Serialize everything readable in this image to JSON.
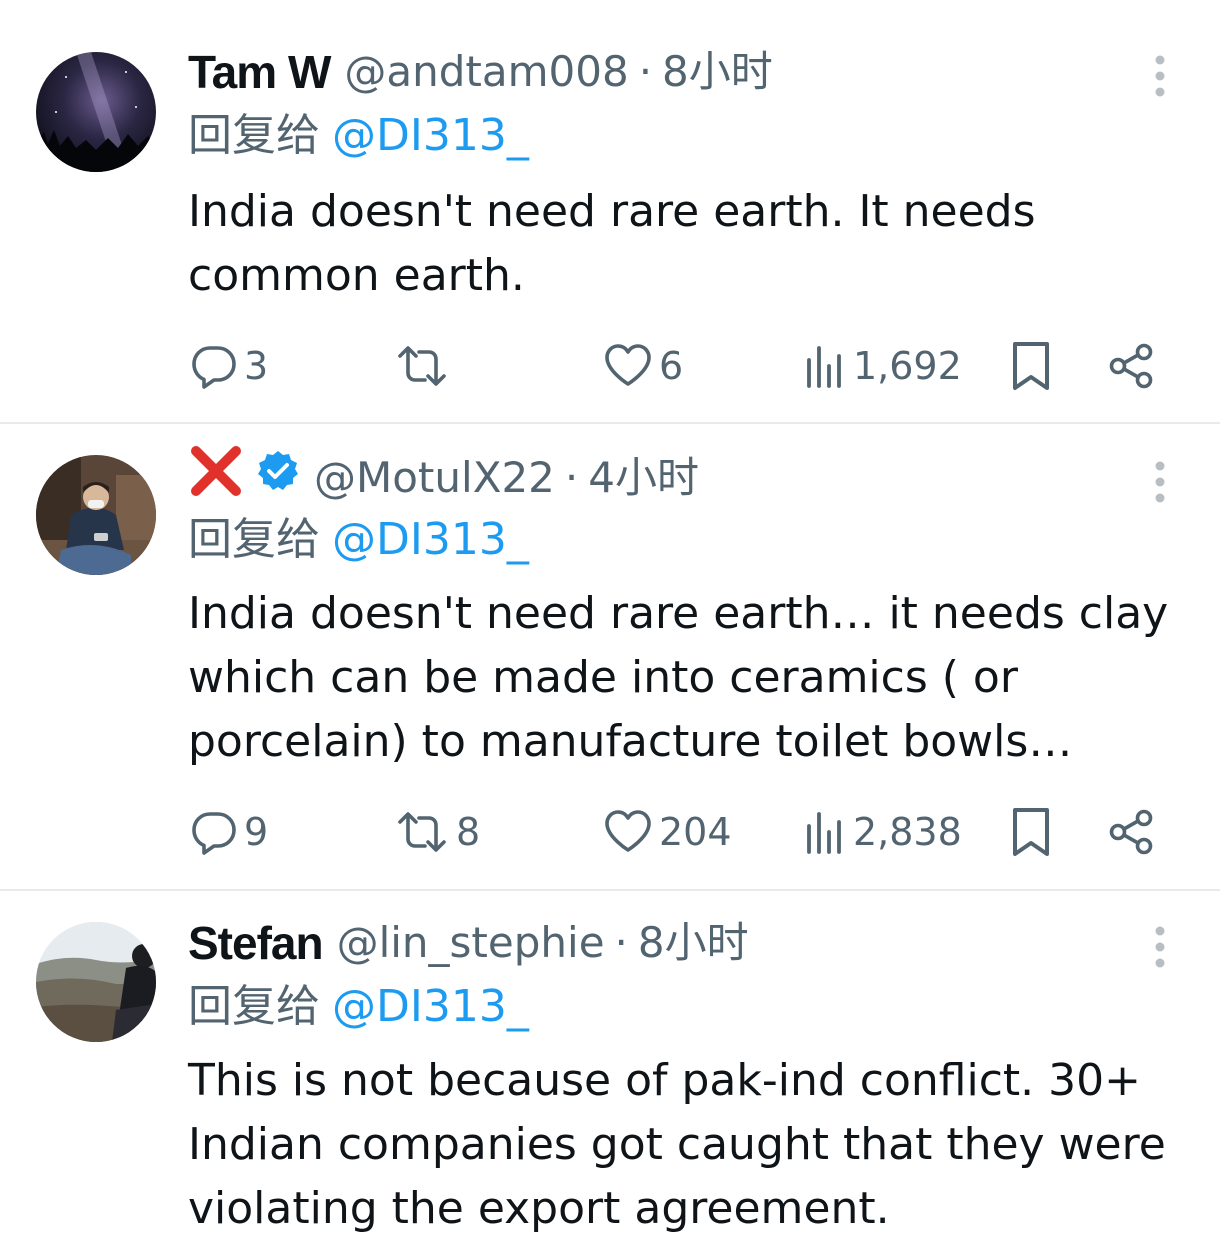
{
  "reply_prefix": "回复给",
  "tweets": [
    {
      "name": "Tam W",
      "handle": "@andtam008",
      "time": "8小时",
      "reply_to": "@DI313_",
      "text": "India doesn't need rare earth. It needs common earth.",
      "replies": "3",
      "retweets": "",
      "likes": "6",
      "views": "1,692"
    },
    {
      "name": "",
      "name_icon": "red-x-emoji",
      "verified": true,
      "handle": "@MotulX22",
      "time": "4小时",
      "reply_to": "@DI313_",
      "text": "India doesn't need rare earth… it needs clay which can be made into ceramics ( or porcelain) to manufacture toilet bowls…",
      "replies": "9",
      "retweets": "8",
      "likes": "204",
      "views": "2,838"
    },
    {
      "name": "Stefan",
      "handle": "@lin_stephie",
      "time": "8小时",
      "reply_to": "@DI313_",
      "text": "This is not because of pak-ind conflict. 30+ Indian companies got caught that they were violating the export agreement."
    }
  ],
  "colors": {
    "accent": "#1d9bf0",
    "text": "#0f1419",
    "muted": "#536471",
    "divider": "#e8ebee"
  }
}
